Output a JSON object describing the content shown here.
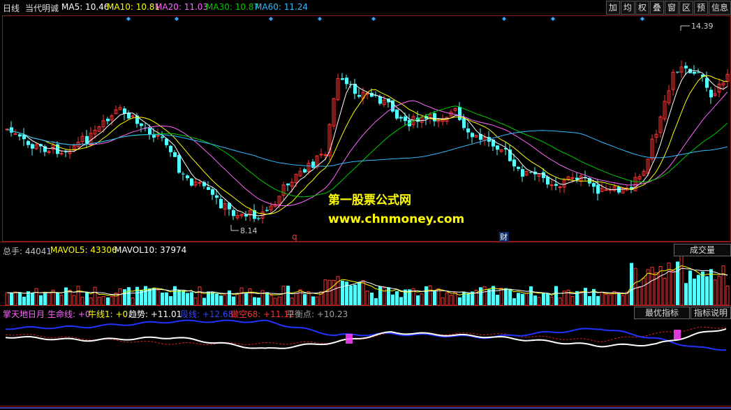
{
  "header": {
    "period": "日线",
    "stock_name": "当代明诚",
    "ma5": "MA5: 10.46",
    "ma10": "MA10: 10.81",
    "ma20": "MA20: 11.03",
    "ma30": "MA30: 10.87",
    "ma60": "MA60: 11.24",
    "buttons": [
      "加",
      "均",
      "权",
      "叠",
      "窗",
      "区",
      "预",
      "信息"
    ],
    "colors": {
      "ma5": "#ffffff",
      "ma10": "#ffff00",
      "ma20": "#ff66ff",
      "ma30": "#00cc00",
      "ma60": "#33bbff"
    }
  },
  "main_chart": {
    "high_label": "14.39",
    "low_label": "8.14",
    "marker_q": "q",
    "marker_cai": "财",
    "watermark_1": "第一股票公式网",
    "watermark_2": "www.chnmoney.com",
    "up_color": "#ff3333",
    "down_color": "#54ffff"
  },
  "volume_panel": {
    "total": "总手: 44041",
    "mavol5": "MAVOL5: 43306",
    "mavol10": "MAVOL10: 37974",
    "select_label": "成交量"
  },
  "indicator_panel": {
    "name": "掌天地日月",
    "life_line": "生命线: +0",
    "bull_line": "牛线1: +0",
    "trend": "趋势: +11.01",
    "band": "段线: +12.68",
    "short": "做空68: +11.12",
    "balance": "平衡点: +10.23",
    "best_btn": "最优指标",
    "explain_btn": "指标说明"
  }
}
